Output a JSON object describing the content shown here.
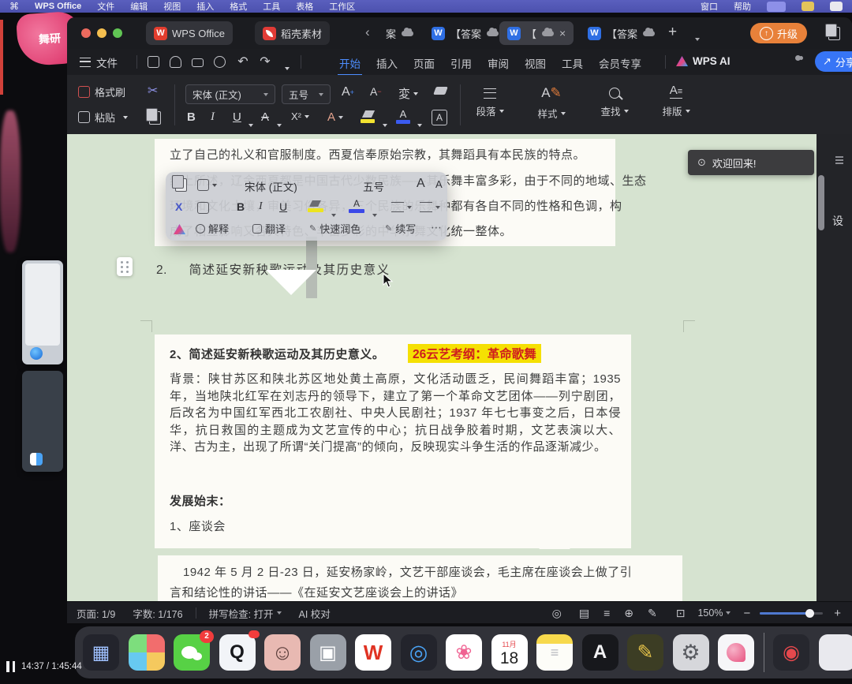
{
  "menubar": {
    "app": "WPS Office",
    "items": [
      "文件",
      "编辑",
      "视图",
      "插入",
      "格式",
      "工具",
      "表格",
      "工作区"
    ],
    "right_items": [
      "窗口",
      "帮助"
    ]
  },
  "tabbar": {
    "home": "WPS Office",
    "docer": "稻壳素材",
    "tabs": [
      {
        "label": "案"
      },
      {
        "label": "【答案"
      },
      {
        "label": "【"
      },
      {
        "label": "【答案"
      }
    ],
    "upgrade": "升级"
  },
  "ribbon": {
    "file": "文件",
    "tabs": [
      "开始",
      "插入",
      "页面",
      "引用",
      "审阅",
      "视图",
      "工具",
      "会员专享"
    ],
    "wps_ai": "WPS AI",
    "share": "分享"
  },
  "fmtbar": {
    "format_painter": "格式刷",
    "paste": "粘贴",
    "font": "宋体 (正文)",
    "size": "五号",
    "groups": [
      "段落",
      "样式",
      "查找",
      "排版"
    ]
  },
  "minibar": {
    "font": "宋体 (正文)",
    "size": "五号",
    "actions": [
      "解释",
      "翻译",
      "快速润色",
      "续写"
    ]
  },
  "notification": "欢迎回来!",
  "doc": {
    "l1": "立了自己的礼义和官服制度。西夏信奉原始宗教，其舞蹈具有本民族的特点。",
    "l2": "综上所述，辽金西夏都是中国古代少数民族——其乐舞丰富多彩，由于不同的地域、生态",
    "l3": "环境和文化土壤，审美习俗各异，三个民族的乐舞种都有各自不同的性格和色调，构",
    "l4": "成了相互影响又各具特色、丰富多彩的中华乐舞文化统一整体。",
    "q_num": "2.",
    "q_text": "简述延安新秧歌运动及其历史意义",
    "ans_heading": "2、简述延安新秧歌运动及其历史意义。",
    "exam_tag": "26云艺考纲：革命歌舞",
    "background": "背景：陕甘苏区和陕北苏区地处黄土高原，文化活动匮乏，民间舞蹈丰富；1935 年，当地陕北红军在刘志丹的领导下，建立了第一个革命文艺团体——列宁剧团，后改名为中国红军西北工农剧社、中央人民剧社；1937 年七七事变之后，日本侵华，抗日救国的主题成为文艺宣传的中心；抗日战争胶着时期，文艺表演以大、洋、古为主，出现了所谓“关门提高”的倾向，反映现实斗争生活的作品逐渐减少。",
    "dev_heading": "发展始末：",
    "dev_item": "1、座谈会",
    "np1": "1942 年 5 月 2 日-23 日，延安杨家岭，文艺干部座谈会，毛主席在座谈会上做了引",
    "np2": "言和结论性的讲话——《在延安文艺座谈会上的讲话》"
  },
  "right_panel": {
    "label": "设"
  },
  "statusbar": {
    "page": "页面: 1/9",
    "words": "字数: 1/176",
    "spell": "拼写检查: 打开",
    "ai": "AI 校对",
    "zoom": "150%"
  },
  "dock": {
    "wechat_badge": "2",
    "calendar": {
      "month": "11月",
      "day": "18"
    }
  },
  "player": {
    "time": "14:37 / 1:45:44"
  },
  "wallpaper": {
    "label": "舞研"
  },
  "colors": {
    "accent_blue": "#4d8dff",
    "upgrade_orange": "#e8813a",
    "doc_green": "#d6e3d0",
    "highlight_yellow": "#f5e003",
    "highlight_red": "#cf1d1d"
  },
  "glyphs": {
    "apple": "⌘",
    "w": "W",
    "close": "×",
    "plus": "+",
    "back": "‹",
    "undo": "↶",
    "redo": "↷",
    "scissors": "✂",
    "cut_x": "X",
    "b": "B",
    "i": "I",
    "u": "U",
    "strike": "A",
    "sup": "X²",
    "outline_a": "A",
    "boxed_a": "A",
    "grow": "A",
    "shrink": "A",
    "text_effect": "変",
    "up": "↑",
    "share": "↗",
    "ellipsis": "⋯",
    "pin": "⊙",
    "eye": "◎",
    "page_view": "▤",
    "outline_view": "≡",
    "web_view": "⊕",
    "pen": "✎",
    "focus": "⊡",
    "minus": "−",
    "q": "Q",
    "face": "☺",
    "gear": "⚙",
    "flower": "❀",
    "grid": "▦",
    "lines": "≡",
    "a_app": "A",
    "rec": "◉",
    "tool": "▣",
    "compass": "◎"
  }
}
